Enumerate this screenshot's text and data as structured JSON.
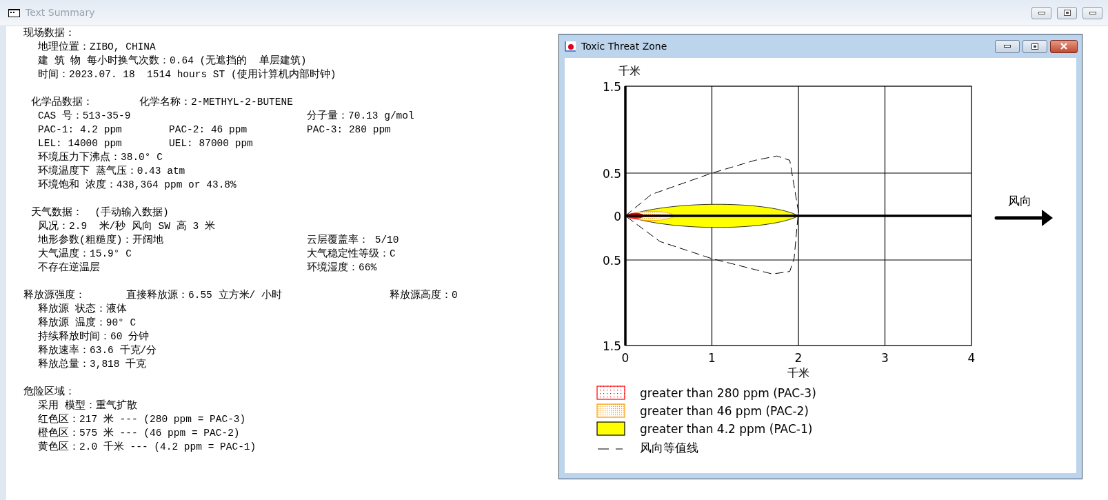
{
  "window": {
    "title": "Text Summary"
  },
  "summary": [
    {
      "lines": [
        {
          "kind": "heading",
          "parts": [
            "现场数据："
          ]
        },
        {
          "kind": "item",
          "parts": [
            "地理位置：ZIBO, CHINA"
          ]
        },
        {
          "kind": "item",
          "parts": [
            "建 筑 物 每小时换气次数：0.64 (无遮挡的  单层建筑)"
          ]
        },
        {
          "kind": "item",
          "parts": [
            "时间：2023.07. 18  1514 hours ST (使用计算机内部时钟)"
          ]
        }
      ]
    },
    {
      "lines": [
        {
          "kind": "subheading",
          "parts": [
            "化学品数据：",
            "化学名称：2-METHYL-2-BUTENE"
          ]
        },
        {
          "kind": "pair",
          "parts": [
            "CAS 号：513-35-9",
            "分子量：70.13 g/mol"
          ]
        },
        {
          "kind": "triple",
          "parts": [
            "PAC-1: 4.2 ppm",
            "PAC-2: 46 ppm",
            "PAC-3: 280 ppm"
          ]
        },
        {
          "kind": "triple",
          "parts": [
            "LEL: 14000 ppm",
            "UEL: 87000 ppm"
          ]
        },
        {
          "kind": "item",
          "parts": [
            "环境压力下沸点：38.0° C"
          ]
        },
        {
          "kind": "item",
          "parts": [
            "环境温度下 蒸气压：0.43 atm"
          ]
        },
        {
          "kind": "item",
          "parts": [
            "环境饱和 浓度：438,364 ppm or 43.8%"
          ]
        }
      ]
    },
    {
      "lines": [
        {
          "kind": "subheading",
          "parts": [
            "天气数据：  (手动输入数据)"
          ]
        },
        {
          "kind": "item",
          "parts": [
            "风况：2.9  米/秒 风向 SW 高 3 米"
          ]
        },
        {
          "kind": "pair",
          "parts": [
            "地形参数(粗糙度)：开阔地",
            "云层覆盖率： 5/10"
          ]
        },
        {
          "kind": "pair",
          "parts": [
            "大气温度：15.9° C",
            "大气稳定性等级：C"
          ]
        },
        {
          "kind": "pair",
          "parts": [
            "不存在逆温层",
            "环境湿度：66%"
          ]
        }
      ]
    },
    {
      "lines": [
        {
          "kind": "release",
          "parts": [
            "释放源强度：",
            "直接释放源：6.55 立方米/ 小时",
            "释放源高度：0"
          ]
        },
        {
          "kind": "item",
          "parts": [
            "释放源 状态：液体"
          ]
        },
        {
          "kind": "item",
          "parts": [
            "释放源 温度：90° C"
          ]
        },
        {
          "kind": "item",
          "parts": [
            "持续释放时间：60 分钟"
          ]
        },
        {
          "kind": "item",
          "parts": [
            "释放速率：63.6 千克/分"
          ]
        },
        {
          "kind": "item",
          "parts": [
            "释放总量：3,818 千克"
          ]
        }
      ]
    },
    {
      "lines": [
        {
          "kind": "heading",
          "parts": [
            "危险区域："
          ]
        },
        {
          "kind": "item",
          "parts": [
            "采用 模型：重气扩散"
          ]
        },
        {
          "kind": "item",
          "parts": [
            "红色区：217 米 --- (280 ppm = PAC-3)"
          ]
        },
        {
          "kind": "item",
          "parts": [
            "橙色区：575 米 --- (46 ppm = PAC-2)"
          ]
        },
        {
          "kind": "item",
          "parts": [
            "黄色区：2.0 千米 --- (4.2 ppm = PAC-1)"
          ]
        }
      ]
    }
  ],
  "threat_window": {
    "title": "Toxic Threat Zone",
    "plot": {
      "y_unit": "千米",
      "y_ticks": [
        "1.5",
        "0.5",
        "0",
        "0.5",
        "1.5"
      ],
      "x_ticks": [
        "0",
        "1",
        "2",
        "3",
        "4"
      ],
      "x_unit": "千米",
      "wind_label": "风向"
    },
    "legend": [
      {
        "kind": "dotted",
        "color": "#ff0000",
        "label": "greater than 280 ppm (PAC-3)"
      },
      {
        "kind": "dense",
        "color": "#ff9900",
        "label": "greater than 46 ppm (PAC-2)"
      },
      {
        "kind": "solid",
        "color": "#ffff00",
        "label": "greater than 4.2 ppm (PAC-1)"
      },
      {
        "kind": "dashed",
        "color": "#000000",
        "label": "风向等值线"
      }
    ]
  }
}
